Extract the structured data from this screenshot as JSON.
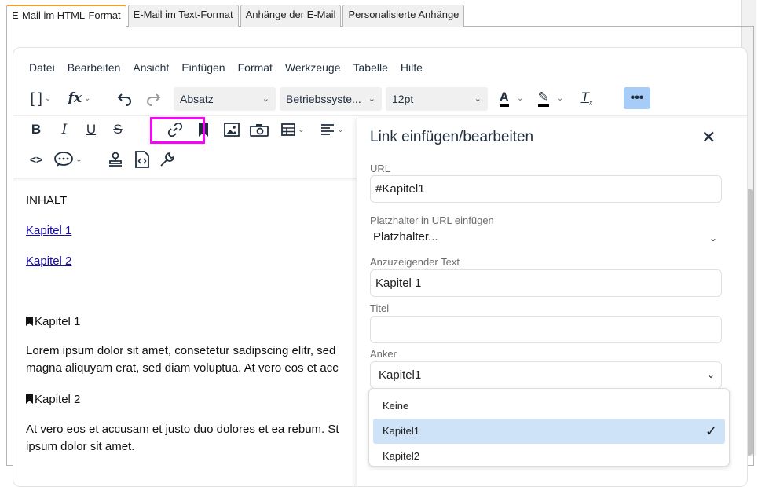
{
  "tabs": [
    "E-Mail im HTML-Format",
    "E-Mail im Text-Format",
    "Anhänge der E-Mail",
    "Personalisierte Anhänge"
  ],
  "menubar": [
    "Datei",
    "Bearbeiten",
    "Ansicht",
    "Einfügen",
    "Format",
    "Werkzeuge",
    "Tabelle",
    "Hilfe"
  ],
  "toolbar": {
    "block_format": "Absatz",
    "font_family": "Betriebssyste...",
    "font_size": "12pt"
  },
  "content": {
    "heading": "INHALT",
    "link1": "Kapitel 1",
    "link2": "Kapitel 2",
    "anchor1": "Kapitel 1",
    "para1_line1": "Lorem ipsum dolor sit amet, consetetur sadipscing elitr, sed",
    "para1_line2": "magna aliquyam erat, sed diam voluptua. At vero eos et acc",
    "anchor2": "Kapitel 2",
    "para2_line1": "At vero eos et accusam et justo duo dolores et ea rebum. St",
    "para2_line2": "ipsum dolor sit amet."
  },
  "dialog": {
    "title": "Link einfügen/bearbeiten",
    "close": "✕",
    "url_label": "URL",
    "url_value": "#Kapitel1",
    "placeholder_label": "Platzhalter in URL einfügen",
    "placeholder_value": "Platzhalter...",
    "text_label": "Anzuzeigender Text",
    "text_value": "Kapitel 1",
    "title_label": "Titel",
    "title_value": "",
    "anchor_label": "Anker",
    "anchor_value": "Kapitel1",
    "anchor_options": [
      "Keine",
      "Kapitel1",
      "Kapitel2"
    ],
    "anchor_selected_index": 1
  }
}
